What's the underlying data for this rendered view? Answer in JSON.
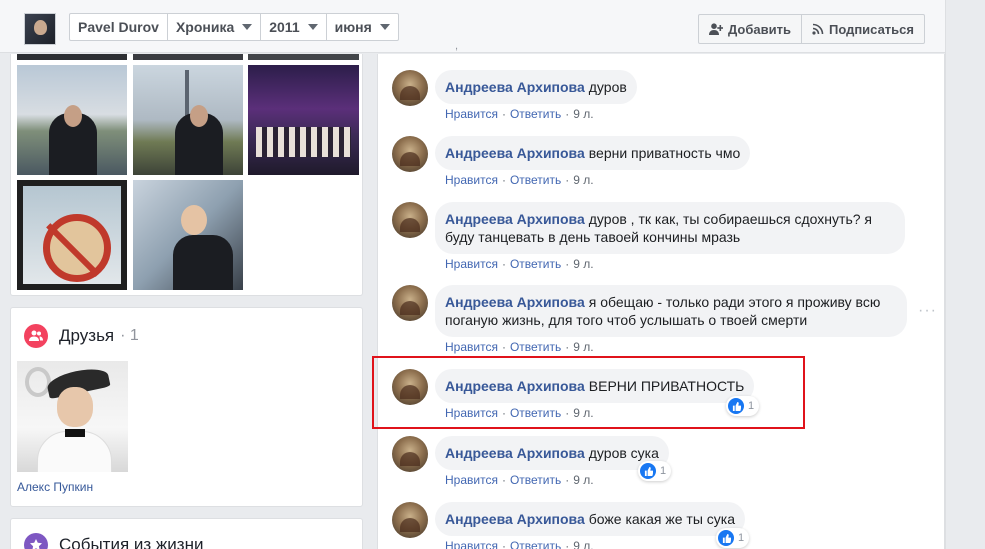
{
  "header": {
    "profile_name": "Pavel Durov",
    "section": "Хроника",
    "year": "2011",
    "month": "июня",
    "add_label": "Добавить",
    "subscribe_label": "Подписаться"
  },
  "friends": {
    "title": "Друзья",
    "count": "· 1",
    "friend_name": "Алекс Пупкин"
  },
  "events": {
    "title": "События из жизни"
  },
  "actions": {
    "like": "Нравится",
    "reply": "Ответить",
    "time": "9 л."
  },
  "comments": [
    {
      "author": "Андреева Архипова",
      "text": "дуров",
      "reactions": ""
    },
    {
      "author": "Андреева Архипова",
      "text": "верни приватность чмо",
      "reactions": ""
    },
    {
      "author": "Андреева Архипова",
      "text": "дуров , тк как, ты собираешься сдохнуть? я буду танцевать в день тавоей кончины мразь",
      "reactions": ""
    },
    {
      "author": "Андреева Архипова",
      "text": "я обещаю - только ради этого я проживу всю поганую жизнь, для того чтоб услышать о твоей смерти",
      "reactions": ""
    },
    {
      "author": "Андреева Архипова",
      "text": "ВЕРНИ ПРИВАТНОСТЬ",
      "reactions": "1"
    },
    {
      "author": "Андреева Архипова",
      "text": "дуров сука",
      "reactions": "1"
    },
    {
      "author": "Андреева Архипова",
      "text": "боже какая же ты сука",
      "reactions": "1"
    }
  ],
  "colors": {
    "link": "#385898",
    "accent": "#4267b2",
    "highlight": "#e0131b",
    "friends_icon": "#f3425f",
    "events_icon": "#7e57c2"
  }
}
